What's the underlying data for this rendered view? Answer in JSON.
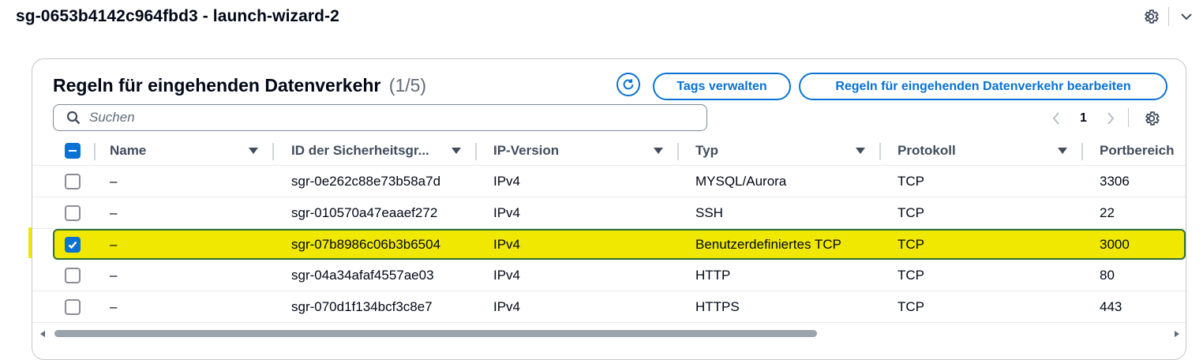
{
  "page": {
    "title": "sg-0653b4142c964fbd3 - launch-wizard-2"
  },
  "panel": {
    "title": "Regeln für eingehenden Datenverkehr",
    "count": "(1/5)",
    "buttons": {
      "manage_tags": "Tags verwalten",
      "edit_inbound_rules": "Regeln für eingehenden Datenverkehr bearbeiten"
    },
    "search": {
      "placeholder": "Suchen",
      "value": ""
    },
    "pagination": {
      "current_page": "1"
    }
  },
  "table": {
    "columns": [
      "Name",
      "ID der Sicherheitsgr...",
      "IP-Version",
      "Typ",
      "Protokoll",
      "Portbereich"
    ],
    "header_checkbox_state": "indeterminate",
    "rows": [
      {
        "selected": false,
        "name": "–",
        "id": "sgr-0e262c88e73b58a7d",
        "ip_version": "IPv4",
        "type": "MYSQL/Aurora",
        "protocol": "TCP",
        "port_range": "3306"
      },
      {
        "selected": false,
        "name": "–",
        "id": "sgr-010570a47eaaef272",
        "ip_version": "IPv4",
        "type": "SSH",
        "protocol": "TCP",
        "port_range": "22"
      },
      {
        "selected": true,
        "name": "–",
        "id": "sgr-07b8986c06b3b6504",
        "ip_version": "IPv4",
        "type": "Benutzerdefiniertes TCP",
        "protocol": "TCP",
        "port_range": "3000"
      },
      {
        "selected": false,
        "name": "–",
        "id": "sgr-04a34afaf4557ae03",
        "ip_version": "IPv4",
        "type": "HTTP",
        "protocol": "TCP",
        "port_range": "80"
      },
      {
        "selected": false,
        "name": "–",
        "id": "sgr-070d1f134bcf3c8e7",
        "ip_version": "IPv4",
        "type": "HTTPS",
        "protocol": "TCP",
        "port_range": "443"
      }
    ]
  },
  "colors": {
    "accent": "#0972d3",
    "selected_row_highlight": "#f0e800",
    "selected_row_border": "#2f6e3a"
  },
  "icons": {
    "header_settings": "gear-icon",
    "header_collapse": "chevron-down-icon",
    "refresh": "refresh-icon",
    "search": "search-icon",
    "prev_page": "chevron-left-icon",
    "next_page": "chevron-right-icon",
    "table_settings": "gear-icon",
    "sort": "caret-down-icon",
    "checked": "check-icon"
  }
}
